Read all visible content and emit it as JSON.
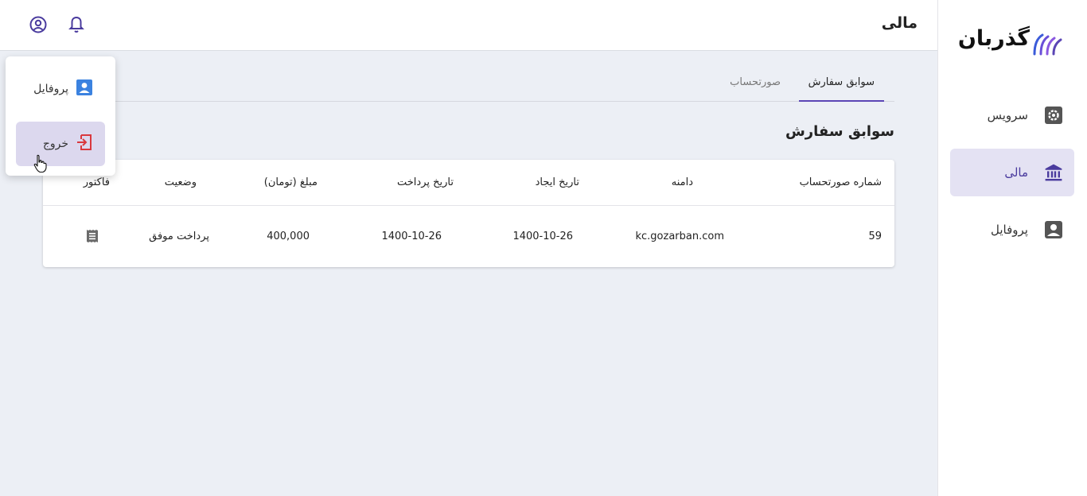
{
  "brand": {
    "logo_text": "گذربان",
    "accent": "#5b46b5",
    "active_bg": "#e4e2f3"
  },
  "sidebar": {
    "items": [
      {
        "label": "سرویس",
        "icon": "gear-icon",
        "active": false
      },
      {
        "label": "مالی",
        "icon": "bank-icon",
        "active": true
      },
      {
        "label": "پروفایل",
        "icon": "account-box-icon",
        "active": false
      }
    ]
  },
  "header": {
    "title": "مالی",
    "icons": [
      "bell-icon",
      "account-circle-icon"
    ]
  },
  "tabs": [
    {
      "label": "سوابق سفارش",
      "active": true
    },
    {
      "label": "صورتحساب",
      "active": false
    }
  ],
  "section": {
    "title": "سوابق سفارش"
  },
  "table": {
    "columns": [
      "شماره صورتحساب",
      "دامنه",
      "تاریخ ایجاد",
      "تاریخ پرداخت",
      "مبلغ (تومان)",
      "وضعیت",
      "فاکتور"
    ],
    "rows": [
      {
        "invoice_no": "59",
        "domain": "kc.gozarban.com",
        "created": "1400-10-26",
        "paid": "1400-10-26",
        "amount": "400,000",
        "status": "پرداخت موفق",
        "invoice_icon": "receipt-icon"
      }
    ]
  },
  "user_menu": {
    "items": [
      {
        "label": "پروفایل",
        "icon": "account-box-icon",
        "color": "#3b82e0"
      },
      {
        "label": "خروج",
        "icon": "logout-icon",
        "color": "#d9383e"
      }
    ]
  }
}
